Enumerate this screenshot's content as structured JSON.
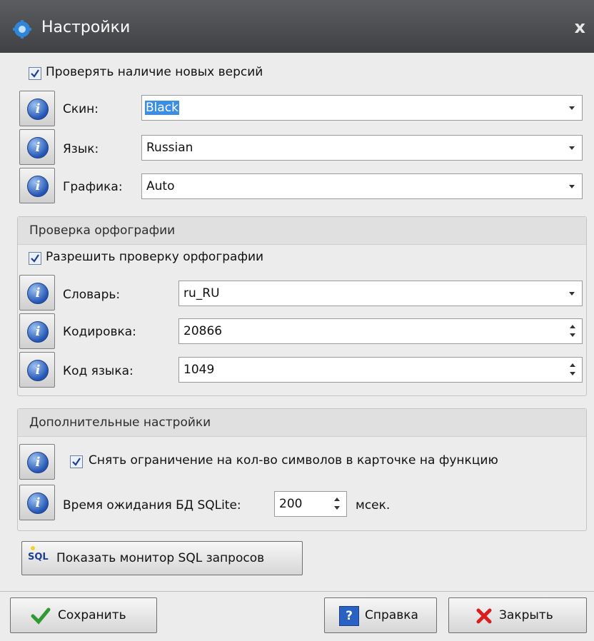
{
  "window": {
    "title": "Настройки",
    "close_label": "x"
  },
  "general": {
    "check_updates": {
      "label": "Проверять наличие новых версий",
      "checked": true
    },
    "skin": {
      "label": "Скин:",
      "value": "Black"
    },
    "language": {
      "label": "Язык:",
      "value": "Russian"
    },
    "graphics": {
      "label": "Графика:",
      "value": "Auto"
    }
  },
  "spellcheck": {
    "header": "Проверка орфографии",
    "enable": {
      "label": "Разрешить проверку орфографии",
      "checked": true
    },
    "dictionary": {
      "label": "Словарь:",
      "value": "ru_RU"
    },
    "encoding": {
      "label": "Кодировка:",
      "value": "20866"
    },
    "lang_code": {
      "label": "Код языка:",
      "value": "1049"
    }
  },
  "advanced": {
    "header": "Дополнительные настройки",
    "remove_limit": {
      "label": "Снять ограничение на кол-во символов в карточке на функцию",
      "checked": true
    },
    "sqlite_timeout": {
      "label": "Время ожидания БД SQLite:",
      "value": "200",
      "unit": "мсек."
    }
  },
  "sql_monitor": {
    "label": "Показать монитор SQL запросов",
    "icon_text": "SQL"
  },
  "footer": {
    "save_label": "Сохранить",
    "help_label": "Справка",
    "close_label": "Закрыть"
  },
  "colors": {
    "titlebar": "#4a4c4f",
    "selection": "#3a8ee6",
    "save_check": "#2f9a2f",
    "close_x": "#d81e1e",
    "help_icon": "#2a62c4"
  }
}
